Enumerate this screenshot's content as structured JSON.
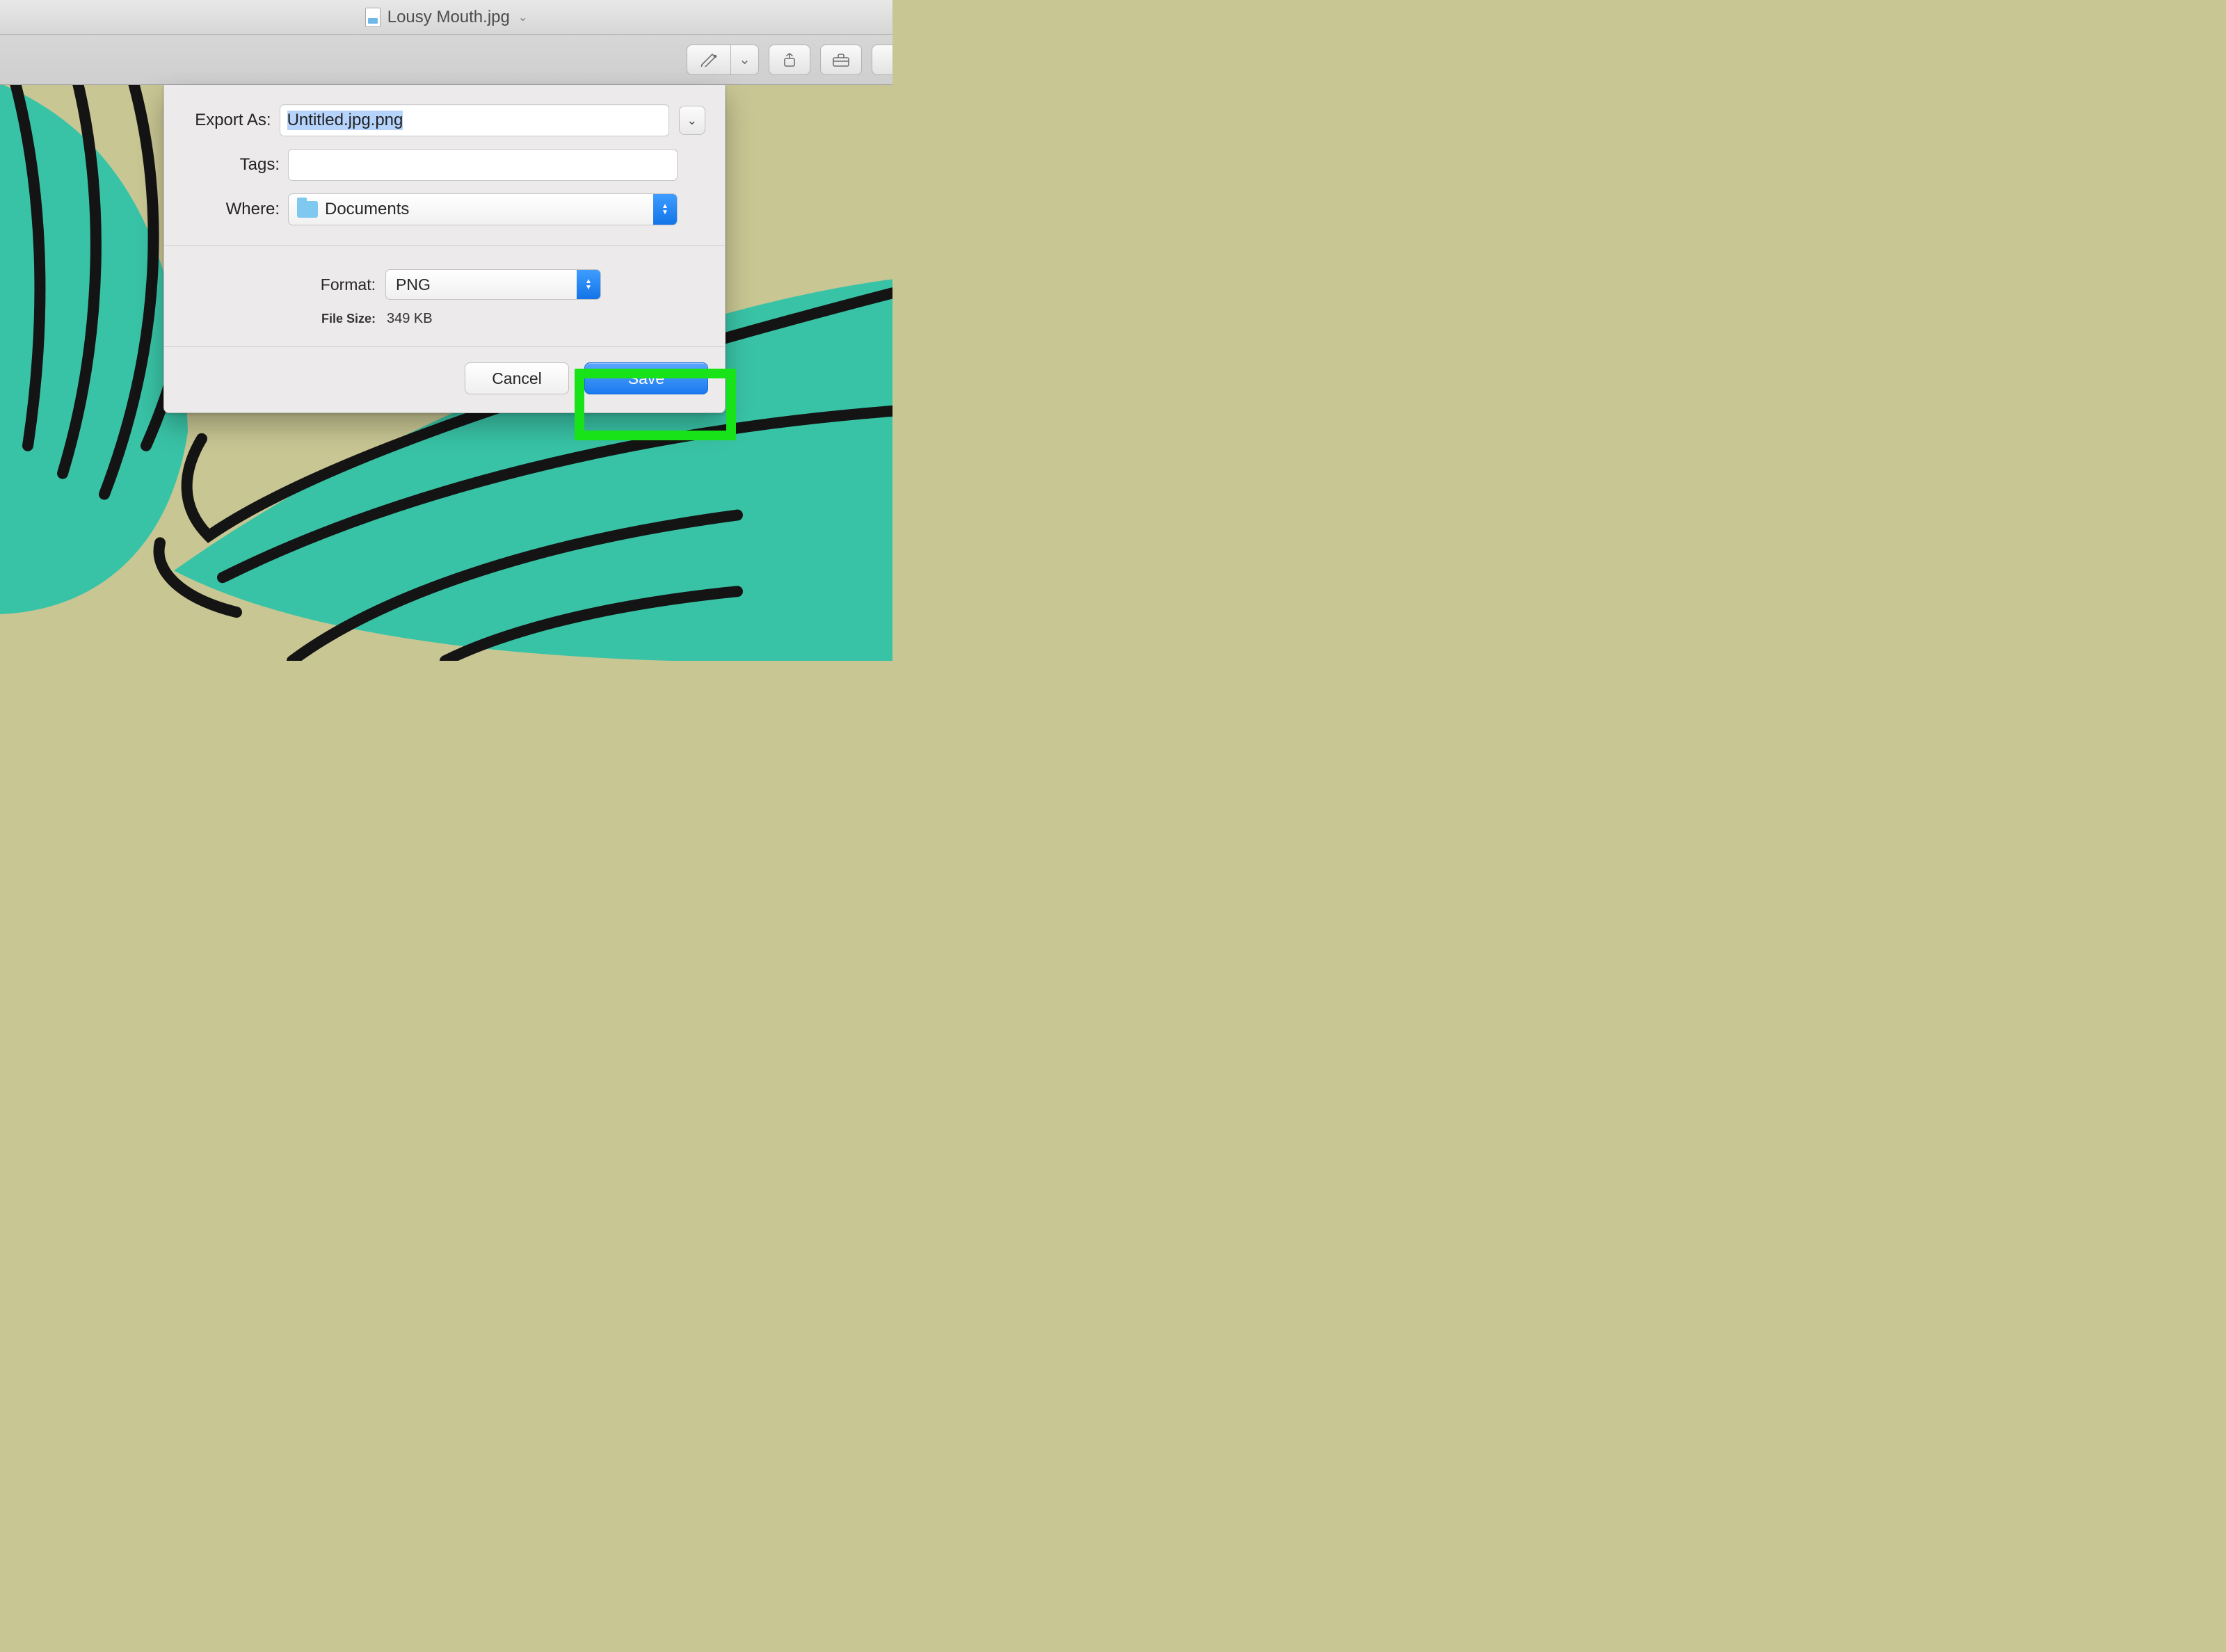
{
  "window": {
    "title": "Lousy Mouth.jpg"
  },
  "toolbar": {
    "markup_icon": "markup-pencil-icon",
    "rotate_icon": "rotate-icon",
    "share_icon": "toolbox-icon"
  },
  "dialog": {
    "labels": {
      "export_as": "Export As:",
      "tags": "Tags:",
      "where": "Where:",
      "format": "Format:",
      "file_size": "File Size:"
    },
    "export_as_value": "Untitled.jpg.png",
    "tags_value": "",
    "where_value": "Documents",
    "format_value": "PNG",
    "file_size_value": "349 KB",
    "buttons": {
      "cancel": "Cancel",
      "save": "Save"
    }
  },
  "highlight": {
    "target": "save-button"
  },
  "colors": {
    "canvas_bg_olive": "#c8c693",
    "canvas_shape_teal": "#39c3a6",
    "stroke_black": "#1a1a1a",
    "accent_blue": "#1a7af0",
    "highlight_green": "#18e318"
  }
}
